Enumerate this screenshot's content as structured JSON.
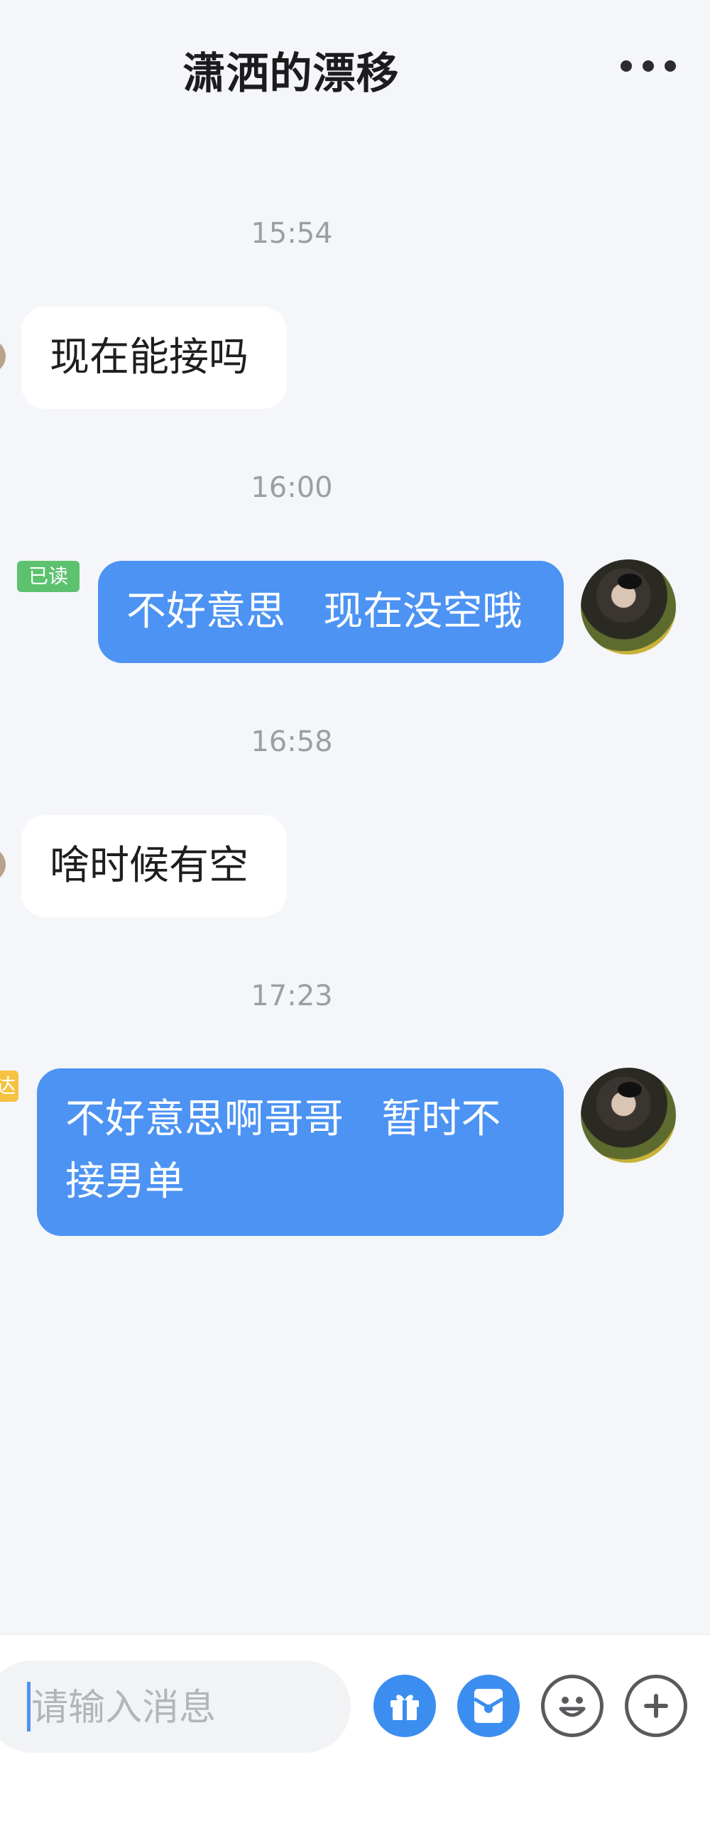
{
  "header": {
    "title": "潇洒的漂移",
    "more_icon": "more-dots-icon"
  },
  "messages": [
    {
      "time": "15:54",
      "direction": "in",
      "text": "现在能接吗"
    },
    {
      "time": "16:00",
      "direction": "out",
      "text": "不好意思   现在没空哦",
      "status": "已读"
    },
    {
      "time": "16:58",
      "direction": "in",
      "text": "啥时候有空"
    },
    {
      "time": "17:23",
      "direction": "out",
      "text": "不好意思啊哥哥   暂时不接男单",
      "status": "达"
    }
  ],
  "input": {
    "placeholder": "请输入消息"
  },
  "toolbar": {
    "icons": [
      "gift-icon",
      "red-packet-icon",
      "emoji-icon",
      "plus-icon"
    ]
  },
  "colors": {
    "outgoing_bubble": "#4c93f3",
    "incoming_bubble": "#ffffff",
    "read_tag": "#5cc26e",
    "delivered_tag": "#f5c242",
    "background": "#f4f6f9"
  }
}
